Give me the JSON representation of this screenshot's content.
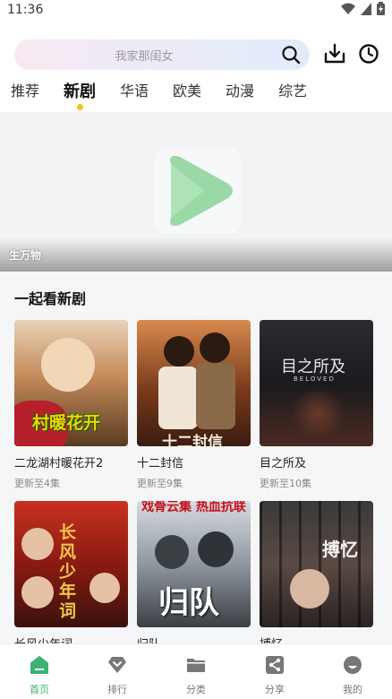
{
  "status": {
    "time": "11:36"
  },
  "search": {
    "placeholder": "我家那闺女"
  },
  "tabs": [
    {
      "label": "推荐"
    },
    {
      "label": "新剧"
    },
    {
      "label": "华语"
    },
    {
      "label": "欧美"
    },
    {
      "label": "动漫"
    },
    {
      "label": "综艺"
    }
  ],
  "banner": {
    "caption": "生万物"
  },
  "section": {
    "title": "一起看新剧"
  },
  "cards": [
    {
      "title": "二龙湖村暖花开2",
      "sub": "更新至4集",
      "poster_text": "村暖花开"
    },
    {
      "title": "十二封信",
      "sub": "更新至9集",
      "poster_text": "十二封信"
    },
    {
      "title": "目之所及",
      "sub": "更新至10集",
      "poster_text": "目之所及",
      "poster_sub": "BELOVED"
    },
    {
      "title": "长风少年词",
      "sub": "",
      "poster_text": "长风少年词"
    },
    {
      "title": "归队",
      "sub": "",
      "poster_text": "归队",
      "poster_top": "戏骨云集 热血抗联"
    },
    {
      "title": "搏忆",
      "sub": "",
      "poster_text": "搏忆"
    }
  ],
  "nav": [
    {
      "label": "首页",
      "icon": "home-icon"
    },
    {
      "label": "排行",
      "icon": "ranking-icon"
    },
    {
      "label": "分类",
      "icon": "folder-icon"
    },
    {
      "label": "分享",
      "icon": "share-icon"
    },
    {
      "label": "我的",
      "icon": "profile-icon"
    }
  ],
  "colors": {
    "accent": "#3cb371",
    "tab_dot": "#f3c21b",
    "play_logo": "#9ad9a6"
  }
}
